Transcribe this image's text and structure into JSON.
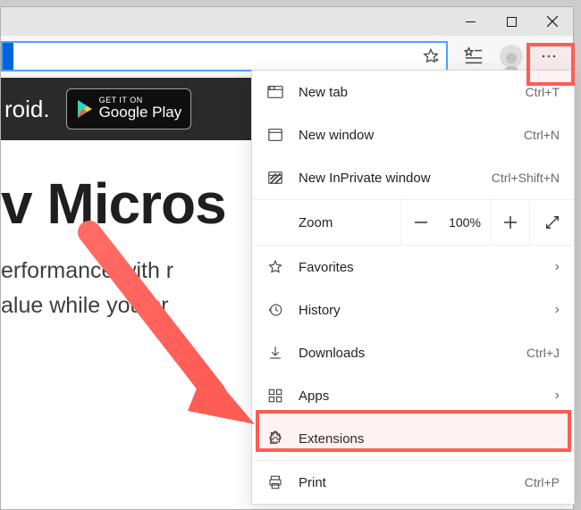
{
  "titlebar": {},
  "toolbar": {
    "url_value": ""
  },
  "page": {
    "banner_text": "roid.",
    "play_small": "GET IT ON",
    "play_big": "Google Play",
    "hero_title": "v Micros",
    "hero_line1": "erformance with r",
    "hero_line2": "alue while you br"
  },
  "menu": {
    "new_tab": "New tab",
    "new_tab_sc": "Ctrl+T",
    "new_window": "New window",
    "new_window_sc": "Ctrl+N",
    "new_inprivate": "New InPrivate window",
    "new_inprivate_sc": "Ctrl+Shift+N",
    "zoom_label": "Zoom",
    "zoom_value": "100%",
    "favorites": "Favorites",
    "history": "History",
    "downloads": "Downloads",
    "downloads_sc": "Ctrl+J",
    "apps": "Apps",
    "extensions": "Extensions",
    "print": "Print",
    "print_sc": "Ctrl+P"
  }
}
